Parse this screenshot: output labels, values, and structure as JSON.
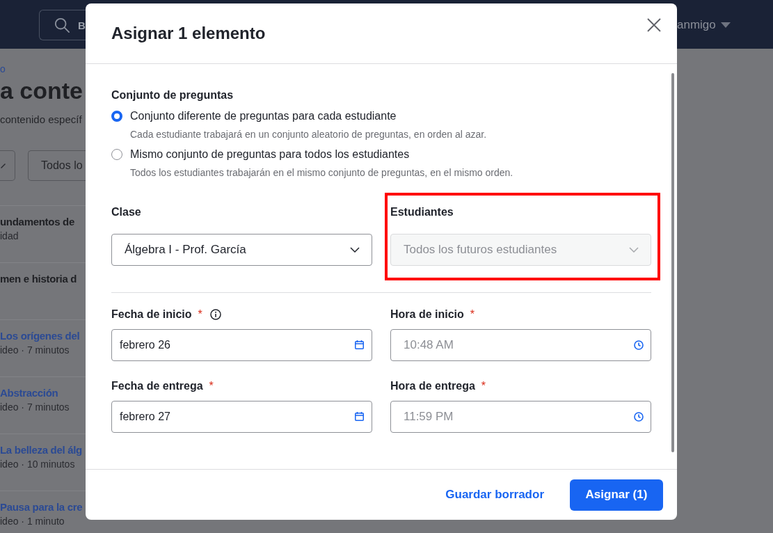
{
  "top_bar": {
    "search": {
      "placeholder": "B"
    },
    "user_menu": {
      "label": "anmigo"
    }
  },
  "page": {
    "breadcrumb": "o",
    "heading": "a conte",
    "description": "contenido específ",
    "filter_button": {
      "label": "Todos lo"
    },
    "items": [
      {
        "kind": "unit",
        "title": "undamentos de",
        "subtitle": "idad"
      },
      {
        "kind": "unit",
        "title": "men e historia d"
      },
      {
        "kind": "video",
        "title": "Los orígenes del",
        "subtitle": "ideo · 7 minutos"
      },
      {
        "kind": "video",
        "title": "Abstracción",
        "subtitle": "ideo · 7 minutos"
      },
      {
        "kind": "video",
        "title": "La belleza del álg",
        "subtitle": "ideo · 10 minutos"
      },
      {
        "kind": "video",
        "title": "Pausa para la cre",
        "subtitle": "ideo · 1 minuto"
      }
    ]
  },
  "dialog": {
    "title": "Asignar 1 elemento",
    "question_set": {
      "label": "Conjunto de preguntas",
      "options": [
        {
          "label": "Conjunto diferente de preguntas para cada estudiante",
          "description": "Cada estudiante trabajará en un conjunto aleatorio de preguntas, en orden al azar.",
          "selected": true
        },
        {
          "label": "Mismo conjunto de preguntas para todos los estudiantes",
          "description": "Todos los estudiantes trabajarán en el mismo conjunto de preguntas, en el mismo orden.",
          "selected": false
        }
      ]
    },
    "selects": [
      {
        "label": "Clase",
        "value": "Álgebra I - Prof. García",
        "disabled": false,
        "highlighted": false
      },
      {
        "label": "Estudiantes",
        "value": "Todos los futuros estudiantes",
        "disabled": true,
        "highlighted": true
      }
    ],
    "schedule_fields": [
      {
        "kind": "date",
        "label": "Fecha de inicio",
        "required_mark": "*",
        "info": true,
        "value": "febrero 26"
      },
      {
        "kind": "time",
        "label": "Hora de inicio",
        "required_mark": "*",
        "value": "10:48 AM"
      },
      {
        "kind": "date",
        "label": "Fecha de entrega",
        "required_mark": "*",
        "value": "febrero 27"
      },
      {
        "kind": "time",
        "label": "Hora de entrega",
        "required_mark": "*",
        "value": "11:59 PM"
      }
    ],
    "footer": {
      "secondary_button": "Guardar borrador",
      "primary_button": "Asignar (1)"
    }
  }
}
